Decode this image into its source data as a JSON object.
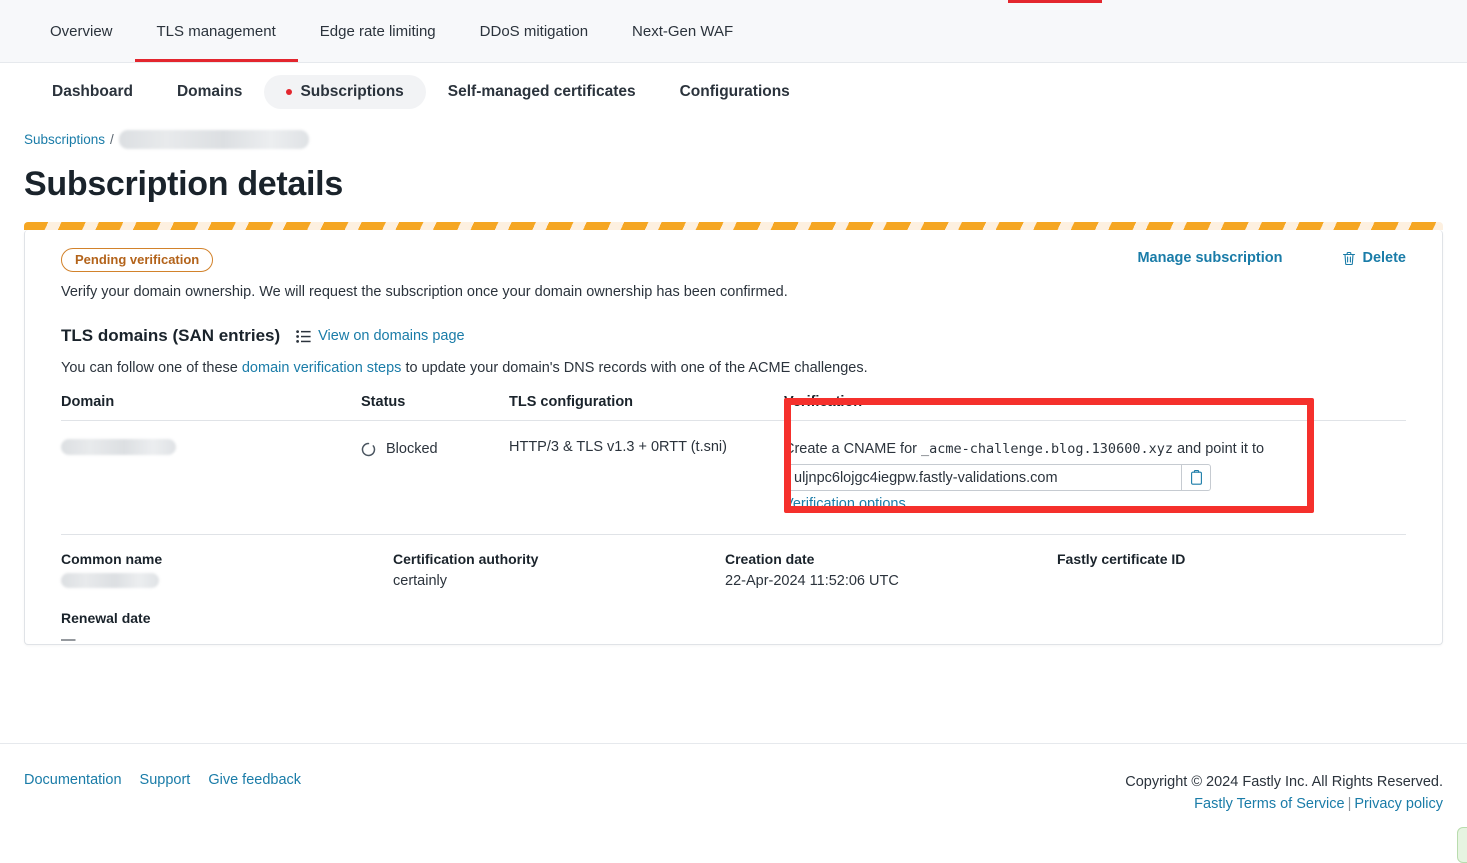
{
  "top_nav": {
    "tabs": [
      {
        "label": "Overview",
        "active": false
      },
      {
        "label": "TLS management",
        "active": true
      },
      {
        "label": "Edge rate limiting",
        "active": false
      },
      {
        "label": "DDoS mitigation",
        "active": false
      },
      {
        "label": "Next-Gen WAF",
        "active": false
      }
    ]
  },
  "sub_nav": {
    "tabs": [
      {
        "label": "Dashboard",
        "active": false
      },
      {
        "label": "Domains",
        "active": false
      },
      {
        "label": "Subscriptions",
        "active": true
      },
      {
        "label": "Self-managed certificates",
        "active": false
      },
      {
        "label": "Configurations",
        "active": false
      }
    ]
  },
  "breadcrumb": {
    "root_label": "Subscriptions",
    "separator": "/",
    "current_label": ""
  },
  "page": {
    "title": "Subscription details"
  },
  "card": {
    "status_badge": "Pending verification",
    "description": "Verify your domain ownership. We will request the subscription once your domain ownership has been confirmed.",
    "manage_label": "Manage subscription",
    "delete_label": "Delete",
    "section_title": "TLS domains (SAN entries)",
    "view_domains_label": "View on domains page",
    "help_prefix": "You can follow one of these ",
    "help_link": "domain verification steps",
    "help_suffix": " to update your domain's DNS records with one of the ACME challenges."
  },
  "table": {
    "headers": {
      "domain": "Domain",
      "status": "Status",
      "tls_configuration": "TLS configuration",
      "verification": "Verification"
    },
    "rows": [
      {
        "domain": "",
        "status": "Blocked",
        "tls_configuration": "HTTP/3 & TLS v1.3 + 0RTT (t.sni)",
        "verification": {
          "instruction_prefix": "Create a CNAME for ",
          "cname_record": "_acme-challenge.blog.130600.xyz",
          "instruction_suffix": " and point it to",
          "cname_value": "uljnpc6lojgc4iegpw.fastly-validations.com",
          "options_label": "Verification options..."
        }
      }
    ]
  },
  "details": {
    "common_name_label": "Common name",
    "common_name_value": "",
    "certification_authority_label": "Certification authority",
    "certification_authority_value": "certainly",
    "creation_date_label": "Creation date",
    "creation_date_value": "22-Apr-2024 11:52:06 UTC",
    "fastly_certificate_id_label": "Fastly certificate ID",
    "fastly_certificate_id_value": "",
    "renewal_date_label": "Renewal date",
    "renewal_date_value": "—"
  },
  "footer": {
    "links": [
      "Documentation",
      "Support",
      "Give feedback"
    ],
    "copyright": "Copyright © 2024 Fastly Inc. All Rights Reserved.",
    "terms_label": "Fastly Terms of Service",
    "divider": "|",
    "privacy_label": "Privacy policy"
  },
  "colors": {
    "brand_red": "#e3262e",
    "link_blue": "#1a7ca8",
    "warning_orange": "#f5a623",
    "badge_text": "#b3631a",
    "annotation_red": "#f5302c"
  }
}
